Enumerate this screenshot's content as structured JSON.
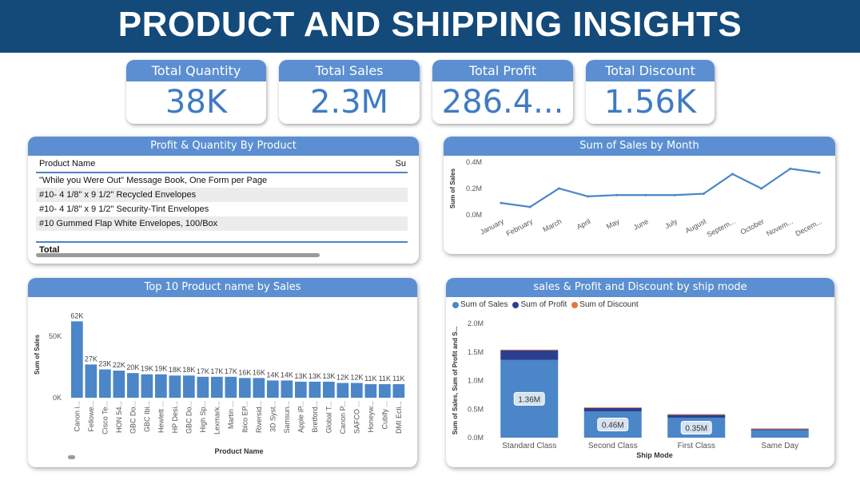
{
  "title": "PRODUCT AND SHIPPING INSIGHTS",
  "kpis": [
    {
      "label": "Total Quantity",
      "value": "38K"
    },
    {
      "label": "Total Sales",
      "value": "2.3M"
    },
    {
      "label": "Total Profit",
      "value": "286.4..."
    },
    {
      "label": "Total Discount",
      "value": "1.56K"
    }
  ],
  "product_table": {
    "title": "Profit & Quantity By Product",
    "col_product": "Product Name",
    "col_second": "Su",
    "rows": [
      "\"While you Were Out\" Message Book, One Form per Page",
      "#10- 4 1/8\" x 9 1/2\" Recycled Envelopes",
      "#10- 4 1/8\" x 9 1/2\" Security-Tint Envelopes",
      "#10 Gummed Flap White Envelopes, 100/Box"
    ],
    "total_label": "Total"
  },
  "colors": {
    "banner": "#134a7a",
    "header": "#5b8fd1",
    "kpi_value": "#3f7bc4",
    "bar": "#4a86c8",
    "profit": "#2a3f8f",
    "discount": "#e8743b"
  },
  "chart_data": [
    {
      "type": "line",
      "title": "Sum of Sales by Month",
      "ylabel": "Sum of Sales",
      "x": [
        "January",
        "February",
        "March",
        "April",
        "May",
        "June",
        "July",
        "August",
        "Septem...",
        "October",
        "Novem...",
        "Decem..."
      ],
      "values": [
        0.09,
        0.06,
        0.2,
        0.14,
        0.15,
        0.15,
        0.15,
        0.16,
        0.31,
        0.2,
        0.35,
        0.32
      ],
      "ylim": [
        0,
        0.4
      ],
      "yticks": [
        "0.0M",
        "0.2M",
        "0.4M"
      ],
      "yticks_val": [
        0,
        0.2,
        0.4
      ]
    },
    {
      "type": "bar",
      "title": "Top 10 Product name by Sales",
      "xlabel": "Product Name",
      "ylabel": "Sum of Sales",
      "categories": [
        "Canon i...",
        "Fellowe...",
        "Cisco Te...",
        "HON 54...",
        "GBC Do...",
        "GBC Ibi...",
        "Hewlett ...",
        "HP Desi...",
        "GBC Do...",
        "High Sp...",
        "Lexmark...",
        "Martin ...",
        "Ibico EP...",
        "Riversid...",
        "3D Syst...",
        "Samsun...",
        "Apple iP...",
        "Bretford...",
        "Global T...",
        "Canon P...",
        "SAFCO ...",
        "Honeyw...",
        "Cubify ...",
        "DMI Ecli..."
      ],
      "values": [
        62,
        27,
        23,
        22,
        20,
        19,
        19,
        18,
        18,
        17,
        17,
        17,
        16,
        16,
        14,
        14,
        13,
        13,
        13,
        12,
        12,
        11,
        11,
        11
      ],
      "labels": [
        "62K",
        "27K",
        "23K",
        "22K",
        "20K",
        "19K",
        "19K",
        "18K",
        "18K",
        "17K",
        "17K",
        "17K",
        "16K",
        "16K",
        "14K",
        "14K",
        "13K",
        "13K",
        "13K",
        "12K",
        "12K",
        "11K",
        "11K",
        "11K"
      ],
      "ylim": [
        0,
        70
      ],
      "yticks": [
        "0K",
        "50K"
      ],
      "yticks_val": [
        0,
        50
      ]
    },
    {
      "type": "bar",
      "stacked": true,
      "title": "sales & Profit and Discount by ship mode",
      "xlabel": "Ship Mode",
      "ylabel": "Sum of Sales, Sum of Profit and S...",
      "categories": [
        "Standard Class",
        "Second Class",
        "First Class",
        "Same Day"
      ],
      "series": [
        {
          "name": "Sum of Sales",
          "values": [
            1.36,
            0.46,
            0.35,
            0.13
          ]
        },
        {
          "name": "Sum of Profit",
          "values": [
            0.17,
            0.06,
            0.05,
            0.02
          ]
        },
        {
          "name": "Sum of Discount",
          "values": [
            0.001,
            0.0003,
            0.0002,
            0.0001
          ]
        }
      ],
      "data_labels": [
        "1.36M",
        "0.46M",
        "0.35M",
        ""
      ],
      "ylim": [
        0,
        2
      ],
      "yticks": [
        "0.0M",
        "0.5M",
        "1.0M",
        "1.5M",
        "2.0M"
      ],
      "yticks_val": [
        0,
        0.5,
        1.0,
        1.5,
        2.0
      ]
    }
  ]
}
